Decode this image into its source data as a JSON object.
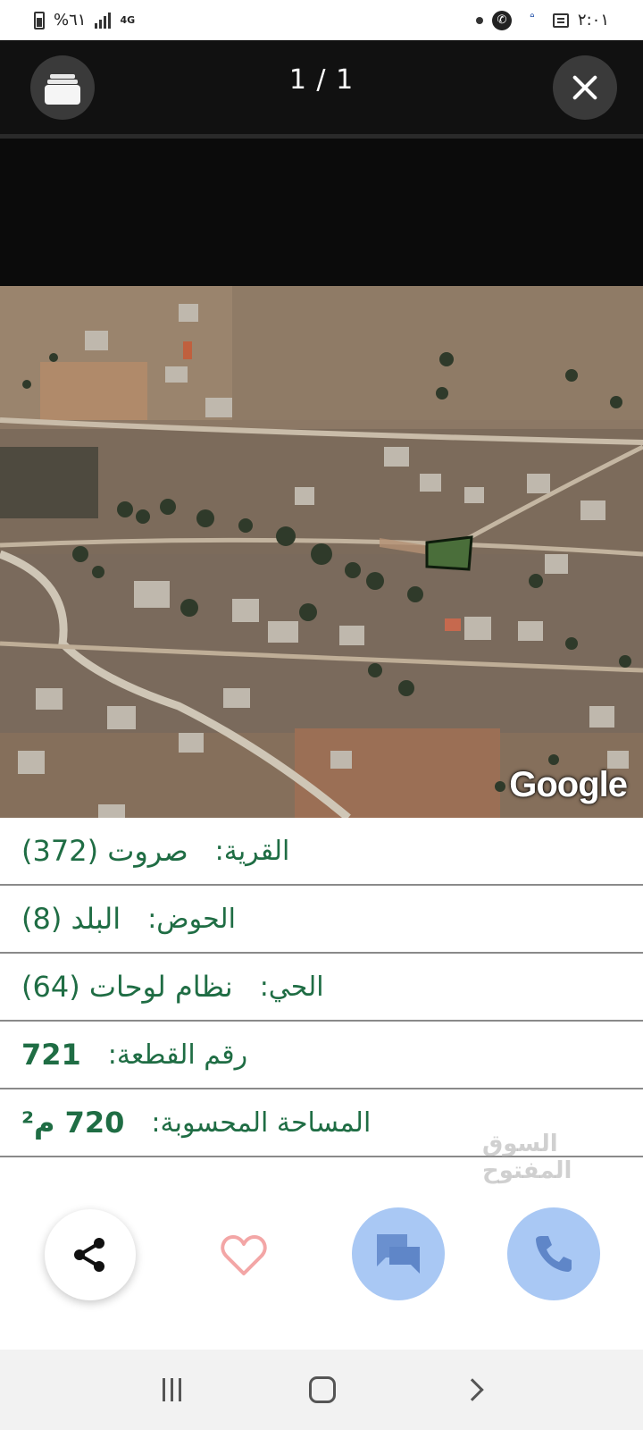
{
  "status_bar": {
    "time": "٢:٠١",
    "battery": "%٦١",
    "network": "4G"
  },
  "viewer": {
    "page_counter": "1 / 1",
    "gallery_icon": "gallery-icon",
    "close_icon": "close-icon"
  },
  "map": {
    "logo": "Google"
  },
  "details": {
    "village_label": "القرية:",
    "village_value": "صروت (372)",
    "basin_label": "الحوض:",
    "basin_value": "البلد (8)",
    "district_label": "الحي:",
    "district_value": "نظام لوحات (64)",
    "plot_label": "رقم القطعة:",
    "plot_value": "721",
    "area_label": "المساحة المحسوبة:",
    "area_value": "720 م²"
  },
  "watermark": "السوق المفتوح",
  "actions": {
    "share_icon": "share-icon",
    "favorite_icon": "heart-icon",
    "chat_icon": "chat-icon",
    "call_icon": "phone-icon"
  },
  "colors": {
    "detail_text": "#1f6d44",
    "action_blue": "#a9c8f4",
    "heart": "#f3a6a6",
    "viewer_bg": "#111111"
  }
}
